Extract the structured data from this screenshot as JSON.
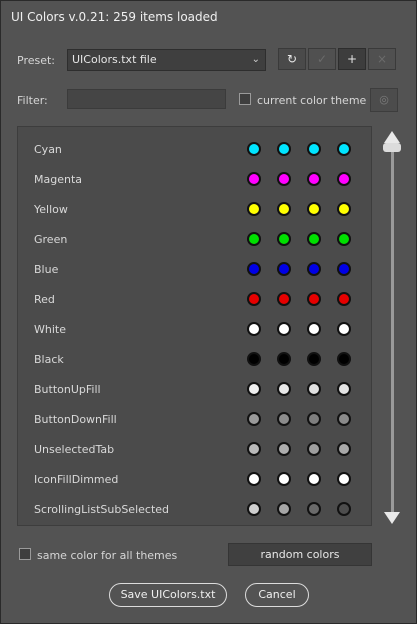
{
  "window": {
    "title": "UI Colors v.0.21: 259 items loaded"
  },
  "preset": {
    "label": "Preset:",
    "selected": "UIColors.txt file",
    "buttons": [
      {
        "icon": "refresh-icon",
        "glyph": "↻",
        "enabled": true
      },
      {
        "icon": "check-icon",
        "glyph": "✓",
        "enabled": false
      },
      {
        "icon": "plus-icon",
        "glyph": "+",
        "enabled": true
      },
      {
        "icon": "close-icon",
        "glyph": "×",
        "enabled": false
      }
    ]
  },
  "filter": {
    "label": "Filter:",
    "value": "",
    "checkbox_label": "current color theme",
    "checkbox_checked": false,
    "button_icon": "settings-icon",
    "button_glyph": "◎"
  },
  "colors": [
    {
      "name": "Cyan",
      "swatches": [
        "#00e5ff",
        "#00e5ff",
        "#00e5ff",
        "#00e5ff"
      ]
    },
    {
      "name": "Magenta",
      "swatches": [
        "#ff00ff",
        "#ff00ff",
        "#ff00ff",
        "#ff00ff"
      ]
    },
    {
      "name": "Yellow",
      "swatches": [
        "#ffff00",
        "#ffff00",
        "#ffff00",
        "#ffff00"
      ]
    },
    {
      "name": "Green",
      "swatches": [
        "#00e000",
        "#00e000",
        "#00e000",
        "#00e000"
      ]
    },
    {
      "name": "Blue",
      "swatches": [
        "#0000e6",
        "#0000e6",
        "#0000e6",
        "#0000e6"
      ]
    },
    {
      "name": "Red",
      "swatches": [
        "#e60000",
        "#e60000",
        "#e60000",
        "#e60000"
      ]
    },
    {
      "name": "White",
      "swatches": [
        "#ffffff",
        "#ffffff",
        "#ffffff",
        "#ffffff"
      ]
    },
    {
      "name": "Black",
      "swatches": [
        "#000000",
        "#000000",
        "#000000",
        "#000000"
      ]
    },
    {
      "name": "ButtonUpFill",
      "swatches": [
        "#f0f0f0",
        "#e8e8e8",
        "#e0e0e0",
        "#e4e4e4"
      ]
    },
    {
      "name": "ButtonDownFill",
      "swatches": [
        "#9a9a9a",
        "#8c8c8c",
        "#7e7e7e",
        "#8a8a8a"
      ]
    },
    {
      "name": "UnselectedTab",
      "swatches": [
        "#b9b9b9",
        "#adadad",
        "#9e9e9e",
        "#a8a8a8"
      ]
    },
    {
      "name": "IconFillDimmed",
      "swatches": [
        "#ffffff",
        "#ffffff",
        "#ffffff",
        "#ffffff"
      ]
    },
    {
      "name": "ScrollingListSubSelected",
      "swatches": [
        "#cfcfcf",
        "#a6a6a6",
        "#6a6a6a",
        "#4d4d4d"
      ]
    }
  ],
  "footer": {
    "same_color_label": "same color for all themes",
    "same_color_checked": false,
    "random_label": "random colors",
    "save_label": "Save UIColors.txt",
    "cancel_label": "Cancel"
  }
}
